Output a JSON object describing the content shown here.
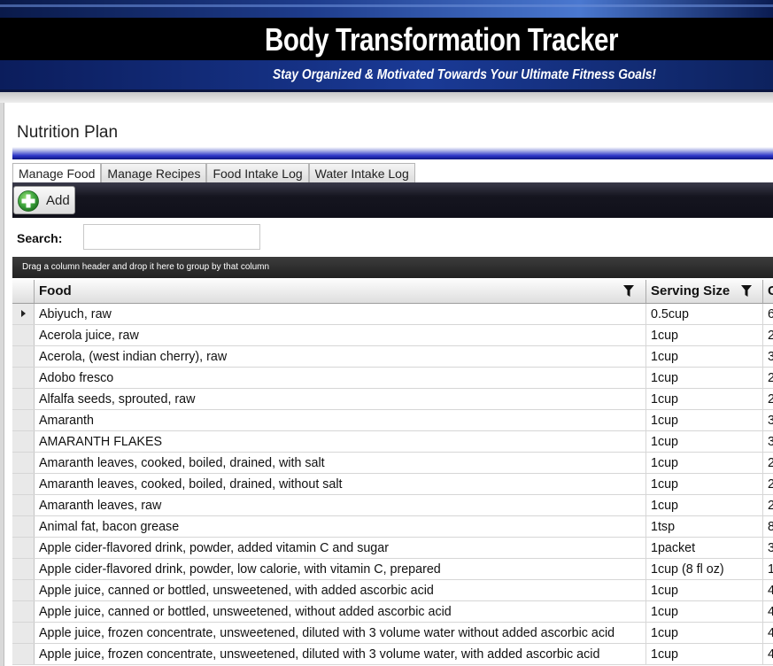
{
  "header": {
    "title": "Body Transformation Tracker",
    "subtitle": "Stay Organized & Motivated Towards Your Ultimate Fitness Goals!"
  },
  "page": {
    "title": "Nutrition Plan"
  },
  "tabs": [
    {
      "label": "Manage Food",
      "active": true
    },
    {
      "label": "Manage Recipes",
      "active": false
    },
    {
      "label": "Food Intake Log",
      "active": false
    },
    {
      "label": "Water Intake Log",
      "active": false
    }
  ],
  "toolbar": {
    "add_label": "Add",
    "add_icon": "plus-circle-icon"
  },
  "search": {
    "label": "Search:",
    "value": "",
    "placeholder": ""
  },
  "grid": {
    "group_hint": "Drag a column header and drop it here to group by that column",
    "columns": [
      {
        "label": "Food",
        "filter_icon": "filter-icon"
      },
      {
        "label": "Serving Size",
        "filter_icon": "filter-icon"
      },
      {
        "label": "C"
      }
    ],
    "rows": [
      {
        "food": "Abiyuch, raw",
        "serving": "0.5cup",
        "cal": "6",
        "current": true
      },
      {
        "food": "Acerola juice, raw",
        "serving": "1cup",
        "cal": "2"
      },
      {
        "food": "Acerola, (west indian cherry), raw",
        "serving": "1cup",
        "cal": "3"
      },
      {
        "food": "Adobo fresco",
        "serving": "1cup",
        "cal": "2"
      },
      {
        "food": "Alfalfa seeds, sprouted, raw",
        "serving": "1cup",
        "cal": "2"
      },
      {
        "food": "Amaranth",
        "serving": "1cup",
        "cal": "3"
      },
      {
        "food": "AMARANTH FLAKES",
        "serving": "1cup",
        "cal": "3"
      },
      {
        "food": "Amaranth leaves, cooked, boiled, drained, with salt",
        "serving": "1cup",
        "cal": "2"
      },
      {
        "food": "Amaranth leaves, cooked, boiled, drained, without salt",
        "serving": "1cup",
        "cal": "2"
      },
      {
        "food": "Amaranth leaves, raw",
        "serving": "1cup",
        "cal": "2"
      },
      {
        "food": "Animal fat, bacon grease",
        "serving": "1tsp",
        "cal": "8"
      },
      {
        "food": "Apple cider-flavored drink, powder, added vitamin C and sugar",
        "serving": "1packet",
        "cal": "3"
      },
      {
        "food": "Apple cider-flavored drink, powder, low calorie, with vitamin C, prepared",
        "serving": "1cup (8 fl oz)",
        "cal": "1"
      },
      {
        "food": "Apple juice, canned or bottled, unsweetened, with added ascorbic acid",
        "serving": "1cup",
        "cal": "4"
      },
      {
        "food": "Apple juice, canned or bottled, unsweetened, without added ascorbic acid",
        "serving": "1cup",
        "cal": "4"
      },
      {
        "food": "Apple juice, frozen concentrate, unsweetened, diluted with 3 volume water without added ascorbic acid",
        "serving": "1cup",
        "cal": "4"
      },
      {
        "food": "Apple juice, frozen concentrate, unsweetened, diluted with 3 volume water, with added ascorbic acid",
        "serving": "1cup",
        "cal": "4"
      }
    ]
  },
  "colors": {
    "banner_blue": "#1a3a96",
    "title_rule_blue": "#2c36c8",
    "add_icon_green": "#3aa13a"
  }
}
